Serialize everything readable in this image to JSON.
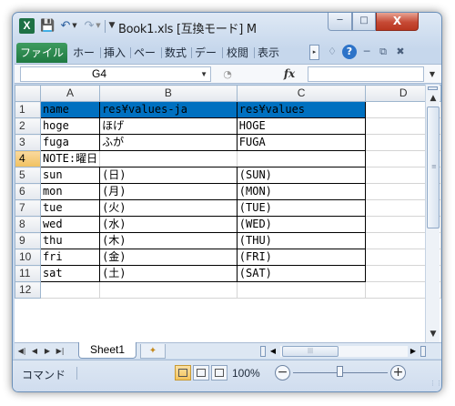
{
  "title_bar": {
    "app_logo": "X",
    "title": "Book1.xls  [互換モード] M",
    "minimize_icon": "minimize-icon",
    "maximize_icon": "maximize-icon",
    "close_label": "X"
  },
  "ribbon": {
    "file_tab": "ファイル",
    "tabs": [
      "ホー",
      "挿入",
      "ペー",
      "数式",
      "デー",
      "校閲",
      "表示"
    ],
    "scroll_glyph": "▸"
  },
  "formula_bar": {
    "name_box": "G4",
    "fx_label": "fx",
    "formula": ""
  },
  "grid": {
    "columns": [
      "A",
      "B",
      "C",
      "D"
    ],
    "rows": [
      {
        "num": "1",
        "a": "name",
        "b": "res¥values-ja",
        "c": "res¥values"
      },
      {
        "num": "2",
        "a": "hoge",
        "b": "ほげ",
        "c": "HOGE"
      },
      {
        "num": "3",
        "a": "fuga",
        "b": "ふが",
        "c": "FUGA"
      },
      {
        "num": "4",
        "a": "NOTE:曜日",
        "b": "",
        "c": ""
      },
      {
        "num": "5",
        "a": "sun",
        "b": "(日)",
        "c": "(SUN)"
      },
      {
        "num": "6",
        "a": "mon",
        "b": "(月)",
        "c": "(MON)"
      },
      {
        "num": "7",
        "a": "tue",
        "b": "(火)",
        "c": "(TUE)"
      },
      {
        "num": "8",
        "a": "wed",
        "b": "(水)",
        "c": "(WED)"
      },
      {
        "num": "9",
        "a": "thu",
        "b": "(木)",
        "c": "(THU)"
      },
      {
        "num": "10",
        "a": "fri",
        "b": "(金)",
        "c": "(FRI)"
      },
      {
        "num": "11",
        "a": "sat",
        "b": "(土)",
        "c": "(SAT)"
      },
      {
        "num": "12",
        "a": "",
        "b": "",
        "c": ""
      }
    ],
    "selected_row": "4",
    "header_fill": "#0070c0"
  },
  "sheets": {
    "active": "Sheet1"
  },
  "status_bar": {
    "mode": "コマンド",
    "zoom": "100%",
    "zoom_minus": "−",
    "zoom_plus": "+"
  },
  "colors": {
    "file_tab": "#1f7a42",
    "selection": "#f1c15f",
    "close_button": "#c64a35"
  }
}
